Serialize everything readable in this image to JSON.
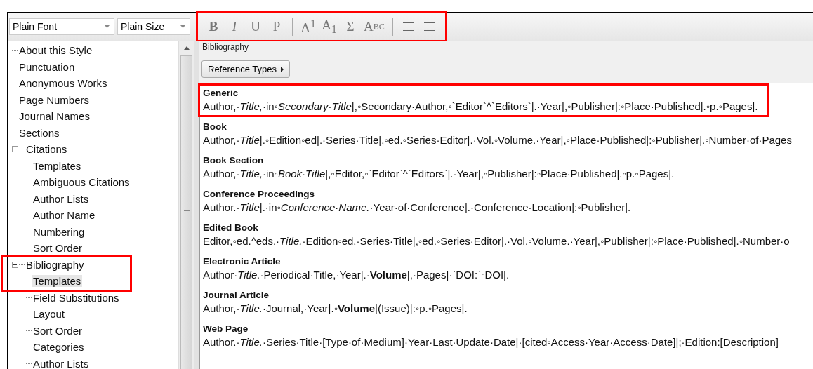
{
  "toolbar": {
    "font": {
      "value": "Plain Font"
    },
    "size": {
      "value": "Plain Size"
    },
    "highlighted": true,
    "groups": [
      [
        {
          "kind": "bold",
          "label": "B"
        },
        {
          "kind": "italic",
          "label": "I"
        },
        {
          "kind": "underline",
          "label": "U"
        },
        {
          "kind": "plain",
          "label": "P"
        }
      ],
      [
        {
          "kind": "superscript",
          "label": "A$^{1}$"
        },
        {
          "kind": "subscript",
          "label": "A$_{1}$"
        },
        {
          "kind": "symbol",
          "label": "Σ"
        },
        {
          "kind": "smallcaps",
          "label": "ABC"
        }
      ],
      [
        {
          "kind": "align-left"
        },
        {
          "kind": "align-center"
        }
      ]
    ]
  },
  "tree": {
    "items": [
      {
        "label": "About this Style",
        "selected": false,
        "highlighted": false
      },
      {
        "label": "Punctuation",
        "selected": false,
        "highlighted": false
      },
      {
        "label": "Anonymous Works",
        "selected": false,
        "highlighted": false
      },
      {
        "label": "Page Numbers",
        "selected": false,
        "highlighted": false
      },
      {
        "label": "Journal Names",
        "selected": false,
        "highlighted": false
      },
      {
        "label": "Sections",
        "selected": false,
        "highlighted": false
      },
      {
        "label": "Citations",
        "selected": false,
        "highlighted": false,
        "expanded": true,
        "children": [
          {
            "label": "Templates",
            "selected": false,
            "highlighted": false
          },
          {
            "label": "Ambiguous Citations",
            "selected": false,
            "highlighted": false
          },
          {
            "label": "Author Lists",
            "selected": false,
            "highlighted": false
          },
          {
            "label": "Author Name",
            "selected": false,
            "highlighted": false
          },
          {
            "label": "Numbering",
            "selected": false,
            "highlighted": false
          },
          {
            "label": "Sort Order",
            "selected": false,
            "highlighted": false
          }
        ]
      },
      {
        "label": "Bibliography",
        "selected": false,
        "highlighted": true,
        "expanded": true,
        "children": [
          {
            "label": "Templates",
            "selected": true,
            "highlighted": true
          },
          {
            "label": "Field Substitutions",
            "selected": false,
            "highlighted": false
          },
          {
            "label": "Layout",
            "selected": false,
            "highlighted": false
          },
          {
            "label": "Sort Order",
            "selected": false,
            "highlighted": false
          },
          {
            "label": "Categories",
            "selected": false,
            "highlighted": false
          },
          {
            "label": "Author Lists",
            "selected": false,
            "highlighted": false
          }
        ]
      }
    ]
  },
  "panel": {
    "title": "Bibliography",
    "reference_types_button": "Reference Types",
    "templates": [
      {
        "name": "Generic",
        "highlighted": true,
        "line": "Author,·*Title,*·in◦*Secondary·Title*|,◦Secondary·Author,◦`Editor`^`Editors`|.·Year|,◦Publisher|:◦Place·Published|.◦p.◦Pages|."
      },
      {
        "name": "Book",
        "highlighted": false,
        "line": "Author,·*Title*|.◦Edition◦ed|.·Series·Title|,◦ed.◦Series·Editor|.·Vol.◦Volume.·Year|,◦Place·Published|:◦Publisher|.◦Number·of·Pages"
      },
      {
        "name": "Book Section",
        "highlighted": false,
        "line": "Author,·*Title,*·in◦*Book·Title*|,◦Editor,◦`Editor`^`Editors`|.·Year|,◦Publisher|:◦Place·Published|.◦p.◦Pages|."
      },
      {
        "name": "Conference Proceedings",
        "highlighted": false,
        "line": "Author.·*Title*|.·in◦*Conference·Name.*·Year·of·Conference|.·Conference·Location|:◦Publisher|."
      },
      {
        "name": "Edited Book",
        "highlighted": false,
        "line": "Editor,◦ed.^eds.·*Title.*·Edition◦ed.·Series·Title|,◦ed.◦Series·Editor|.·Vol.◦Volume.·Year|,◦Publisher|:◦Place·Published|.◦Number·o"
      },
      {
        "name": "Electronic Article",
        "highlighted": false,
        "line": "Author·*Title.*·Periodical·Title,·Year|.·**Volume**|,·Pages|·`DOI:`◦DOI|."
      },
      {
        "name": "Journal Article",
        "highlighted": false,
        "line": "Author,·*Title.*·Journal,·Year|.◦**Volume**|(Issue)|:◦p.◦Pages|."
      },
      {
        "name": "Web Page",
        "highlighted": false,
        "line": "Author.·*Title.*·Series·Title·[Type·of·Medium]·Year·Last·Update·Date|·[cited◦Access·Year·Access·Date]|;·Edition:[Description]"
      }
    ]
  }
}
